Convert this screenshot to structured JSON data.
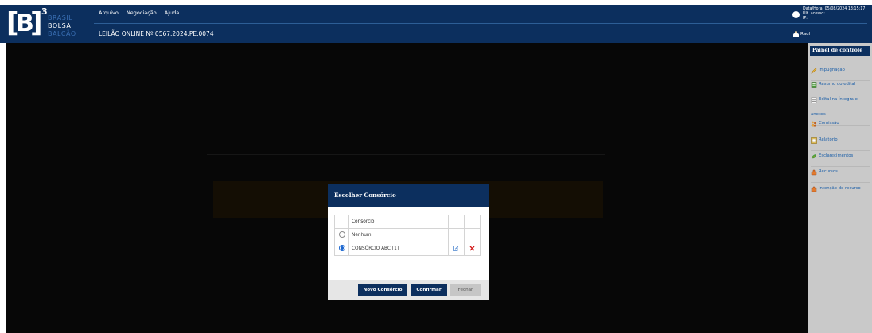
{
  "logo": {
    "bracket_letter": "B",
    "superscript": "3",
    "line1": "BRASIL",
    "line2": "BOLSA",
    "line3": "BALCÃO"
  },
  "menu": {
    "items": [
      "Arquivo",
      "Negociação",
      "Ajuda"
    ]
  },
  "auction": {
    "title": "LEILÃO ONLINE Nº 0567.2024.PE.0074"
  },
  "sysinfo": {
    "datetime": "Data/Hora: 05/08/2024 13:15:17",
    "last_access": "Últ. acesso:",
    "ip": "IP:"
  },
  "user": {
    "name": "Raul"
  },
  "sidebar": {
    "header": "Painel de controle",
    "items": [
      {
        "label": "Impugnação",
        "icon": "pencil-icon",
        "color": "#d8a030"
      },
      {
        "label": "Resumo do edital",
        "icon": "document-green-icon",
        "color": "#3a8a2f"
      },
      {
        "label": "Edital na íntegra e anexos",
        "icon": "document-list-icon",
        "color": "#8a8a8a"
      },
      {
        "label": "Comissão",
        "icon": "people-icon",
        "color": "#d8a030"
      },
      {
        "label": "Relatório",
        "icon": "report-icon",
        "color": "#d8a030"
      },
      {
        "label": "Esclarecimentos",
        "icon": "leaf-icon",
        "color": "#3a8a2f"
      },
      {
        "label": "Recursos",
        "icon": "hand-icon",
        "color": "#d86a2a"
      },
      {
        "label": "Intenção de recurso",
        "icon": "hand-icon",
        "color": "#d86a2a"
      }
    ]
  },
  "modal": {
    "title": "Escolher Consórcio",
    "table": {
      "header": "Consórcio",
      "rows": [
        {
          "name": "Nenhum",
          "selected": false
        },
        {
          "name": "CONSÓRCIO ABC [1]",
          "selected": true
        }
      ]
    },
    "buttons": {
      "novo": "Novo Consórcio",
      "confirmar": "Confirmar",
      "fechar": "Fechar"
    }
  },
  "colors": {
    "navy": "#0c2f5e",
    "sidebar_bg": "#c9c9c9",
    "link_blue": "#1c5fa8"
  }
}
